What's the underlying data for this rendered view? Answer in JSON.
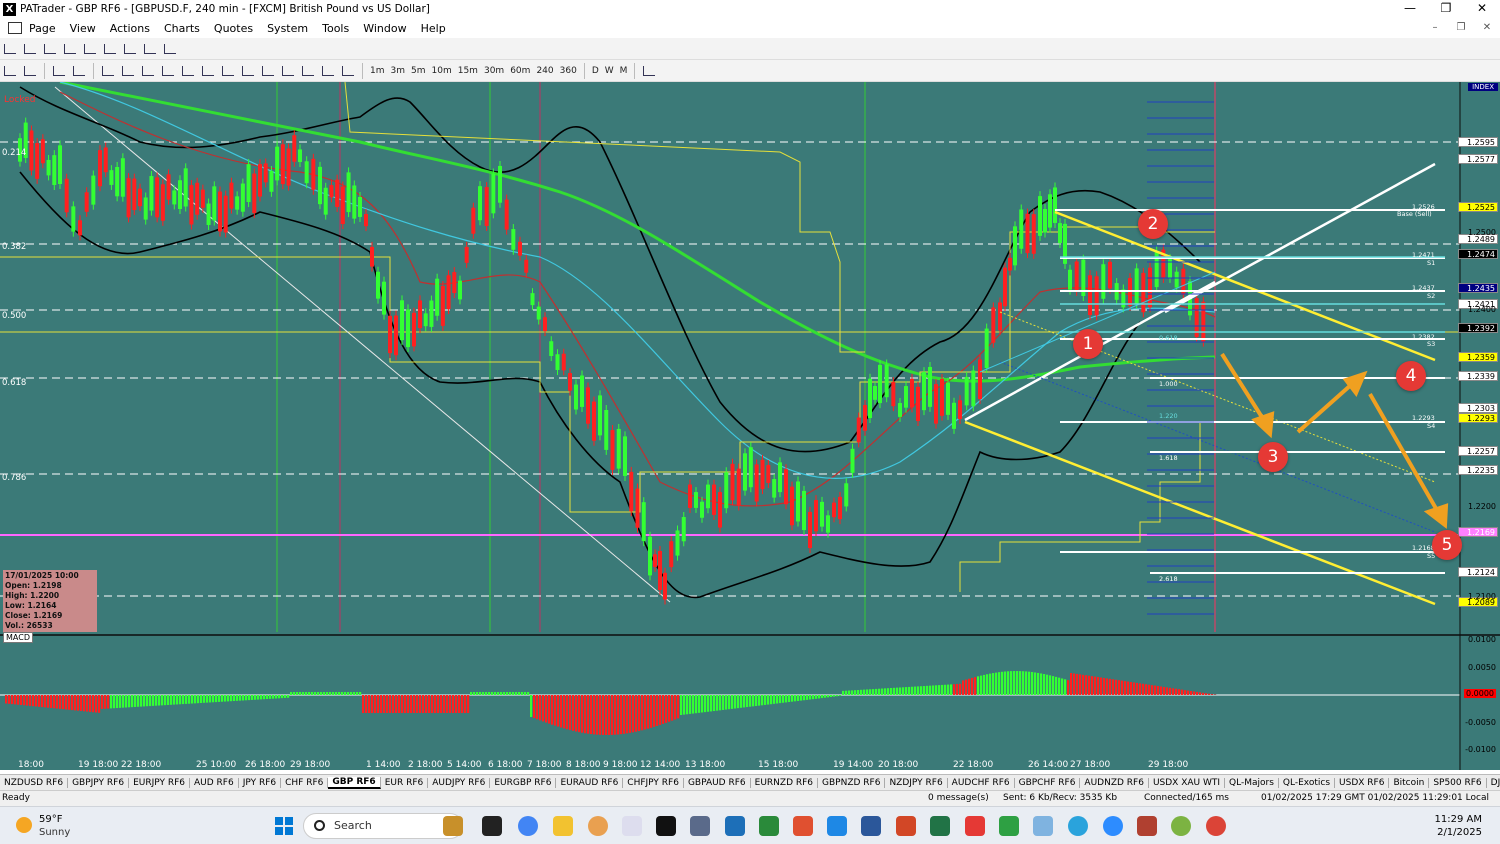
{
  "window": {
    "title": "PATrader - GBP RF6 - [GBPUSD.F, 240 min - [FXCM] British Pound vs US Dollar]",
    "controls": {
      "minimize": "—",
      "maximize": "❐",
      "close": "✕"
    },
    "mdi_controls": {
      "minimize": "–",
      "restore": "❐",
      "close": "✕"
    }
  },
  "menu": [
    "Page",
    "View",
    "Actions",
    "Charts",
    "Quotes",
    "System",
    "Tools",
    "Window",
    "Help"
  ],
  "timeframes": [
    "1m",
    "3m",
    "5m",
    "10m",
    "15m",
    "30m",
    "60m",
    "240",
    "360",
    "D",
    "W",
    "M"
  ],
  "chart": {
    "locked_label": "Locked",
    "index_label": "INDEX",
    "macd_label": "MACD",
    "fib_levels_left": [
      "0.214",
      "0.382",
      "0.500",
      "0.618",
      "0.786"
    ],
    "fib_levels_right": [
      "0.618",
      "1.000",
      "1.220",
      "1.618",
      "2.618"
    ],
    "price_labels": [
      {
        "text": "1.2595",
        "style": "white"
      },
      {
        "text": "1.2577",
        "style": "white"
      },
      {
        "text": "1.2525",
        "style": "yellow"
      },
      {
        "text": "1.2489",
        "style": "white"
      },
      {
        "text": "1.2474",
        "style": "black"
      },
      {
        "text": "1.2435",
        "style": "navy"
      },
      {
        "text": "1.2421",
        "style": "white"
      },
      {
        "text": "1.2392",
        "style": "black"
      },
      {
        "text": "1.2359",
        "style": "yellow"
      },
      {
        "text": "1.2339",
        "style": "white"
      },
      {
        "text": "1.2303",
        "style": "white"
      },
      {
        "text": "1.2293",
        "style": "yellow"
      },
      {
        "text": "1.2257",
        "style": "white"
      },
      {
        "text": "1.2235",
        "style": "white"
      },
      {
        "text": "1.2169",
        "style": "pink"
      },
      {
        "text": "1.2124",
        "style": "white"
      },
      {
        "text": "1.2089",
        "style": "yellow"
      }
    ],
    "axis_ticks": [
      "1.2500",
      "1.2400",
      "1.2200",
      "1.2100"
    ],
    "sr_labels": [
      {
        "text": "1.2526",
        "sub": "Base (Sell)"
      },
      {
        "text": "1.2471",
        "sub": "S1"
      },
      {
        "text": "1.2437",
        "sub": "S2"
      },
      {
        "text": "1.2382",
        "sub": "S3"
      },
      {
        "text": "1.2293",
        "sub": "S4"
      },
      {
        "text": "1.2168",
        "sub": "S5"
      }
    ],
    "info_box": {
      "date": "17/01/2025 10:00",
      "open": "Open: 1.2198",
      "high": "High: 1.2200",
      "low": "Low: 1.2164",
      "close": "Close: 1.2169",
      "vol": "Vol.: 26533"
    },
    "annotations": [
      "1",
      "2",
      "3",
      "4",
      "5"
    ],
    "macd_scale": [
      "0.0100",
      "0.0050",
      "0.0000",
      "-0.0050",
      "-0.0100"
    ],
    "time_labels": [
      "18:00",
      "19 18:00",
      "22 18:00",
      "25 10:00",
      "26 18:00",
      "29 18:00",
      "1 14:00",
      "2 18:00",
      "5 14:00",
      "6 18:00",
      "7 18:00",
      "8 18:00",
      "9 18:00",
      "12 14:00",
      "13 18:00",
      "15 18:00",
      "19 14:00",
      "20 18:00",
      "22 18:00",
      "26 14:00",
      "27 18:00",
      "29 18:00"
    ]
  },
  "symbol_tabs": [
    "NZDUSD RF6",
    "GBPJPY RF6",
    "EURJPY RF6",
    "AUD RF6",
    "JPY RF6",
    "CHF RF6",
    "GBP RF6",
    "EUR RF6",
    "AUDJPY RF6",
    "EURGBP RF6",
    "EURAUD RF6",
    "CHFJPY RF6",
    "GBPAUD RF6",
    "EURNZD RF6",
    "GBPNZD RF6",
    "NZDJPY RF6",
    "AUDCHF RF6",
    "GBPCHF RF6",
    "AUDNZD RF6",
    "USDX XAU WTI",
    "QL-Majors",
    "QL-Exotics",
    "USDX RF6",
    "Bitcoin",
    "SP500 RF6",
    "DJIA"
  ],
  "active_symbol_tab": "GBP RF6",
  "status": {
    "ready": "Ready",
    "messages": "0 message(s)",
    "traffic": "Sent: 6 Kb/Recv: 3535 Kb",
    "connection": "Connected/165 ms",
    "time": "01/02/2025 17:29 GMT   01/02/2025 11:29:01 Local"
  },
  "taskbar": {
    "temp": "59°F",
    "condition": "Sunny",
    "search_placeholder": "Search",
    "clock_time": "11:29 AM",
    "clock_date": "2/1/2025"
  },
  "colors": {
    "chart_bg": "#3b7a78",
    "candle_up": "#33ff33",
    "candle_down": "#ff2020",
    "ma_green": "#33dd33",
    "annotation_red": "#e53935",
    "arrow_orange": "#f0a020",
    "channel_yellow": "#ffee33"
  }
}
